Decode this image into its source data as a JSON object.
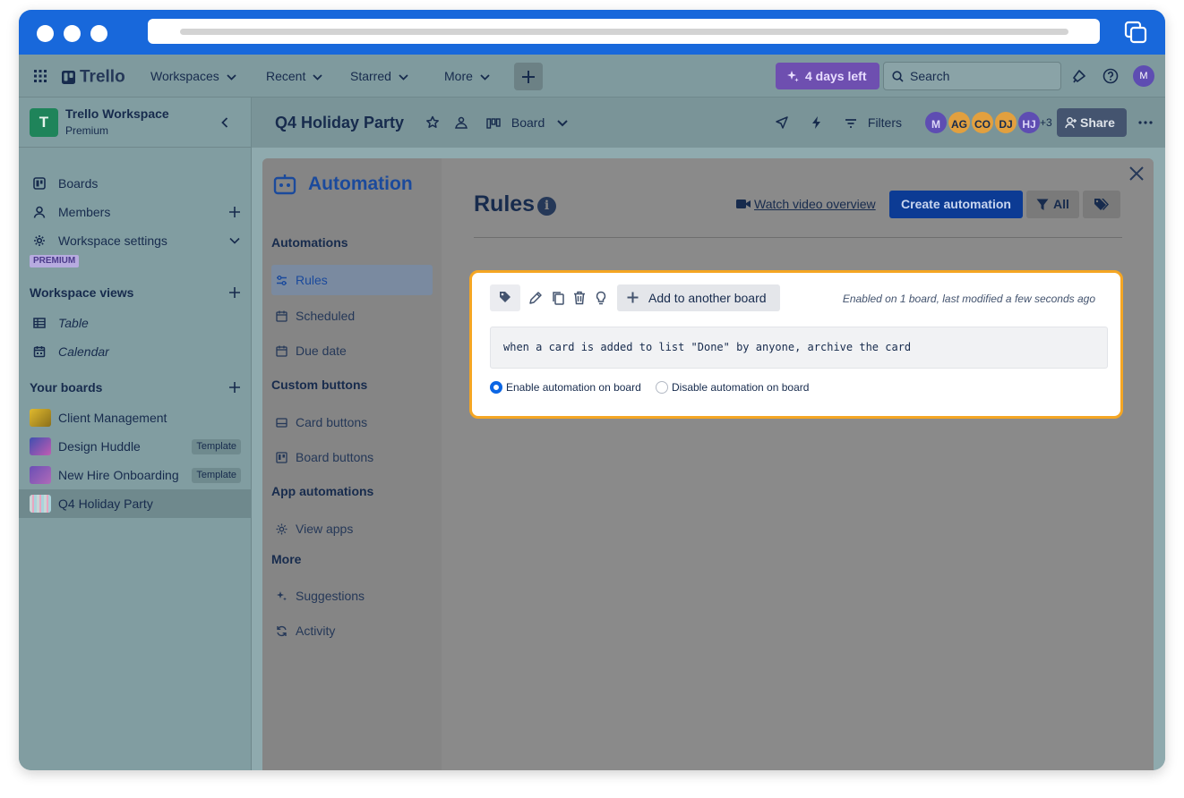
{
  "topnav": {
    "logo": "Trello",
    "menus": [
      "Workspaces",
      "Recent",
      "Starred",
      "More"
    ],
    "trial": "4 days left",
    "search_placeholder": "Search",
    "avatar": "M"
  },
  "sidebar": {
    "workspace_initial": "T",
    "workspace_name": "Trello Workspace",
    "workspace_plan": "Premium",
    "nav": [
      {
        "label": "Boards",
        "icon": "board-icon"
      },
      {
        "label": "Members",
        "icon": "person-icon"
      },
      {
        "label": "Workspace settings",
        "icon": "gear-icon"
      }
    ],
    "premium_tag": "PREMIUM",
    "views_title": "Workspace views",
    "views": [
      {
        "label": "Table",
        "icon": "table-icon"
      },
      {
        "label": "Calendar",
        "icon": "calendar-icon"
      }
    ],
    "boards_title": "Your boards",
    "boards": [
      {
        "label": "Client Management",
        "badge": "",
        "color": "#c9a227"
      },
      {
        "label": "Design Huddle",
        "badge": "Template",
        "color": "#7a4fb0"
      },
      {
        "label": "New Hire Onboarding",
        "badge": "Template",
        "color": "#8a5bb8"
      },
      {
        "label": "Q4 Holiday Party",
        "badge": "",
        "color": "#b8c4c4"
      }
    ]
  },
  "board_header": {
    "title": "Q4 Holiday Party",
    "view": "Board",
    "filters": "Filters",
    "members": [
      {
        "initials": "M",
        "color": "#5e4db2"
      },
      {
        "initials": "AG",
        "color": "#e2a03f"
      },
      {
        "initials": "CO",
        "color": "#e2a03f"
      },
      {
        "initials": "DJ",
        "color": "#e2a03f"
      },
      {
        "initials": "HJ",
        "color": "#5e4db2"
      }
    ],
    "more_members": "+3",
    "share": "Share"
  },
  "automation": {
    "title": "Automation",
    "sections": [
      {
        "title": "Automations",
        "items": [
          {
            "label": "Rules",
            "icon": "sliders-icon",
            "active": true
          },
          {
            "label": "Scheduled",
            "icon": "calendar-icon"
          },
          {
            "label": "Due date",
            "icon": "calendar-icon"
          }
        ]
      },
      {
        "title": "Custom buttons",
        "items": [
          {
            "label": "Card buttons",
            "icon": "card-icon"
          },
          {
            "label": "Board buttons",
            "icon": "board-icon"
          }
        ]
      },
      {
        "title": "App automations",
        "items": [
          {
            "label": "View apps",
            "icon": "gear-icon"
          }
        ]
      },
      {
        "title": "More",
        "items": [
          {
            "label": "Suggestions",
            "icon": "sparkle-icon"
          },
          {
            "label": "Activity",
            "icon": "refresh-icon"
          }
        ]
      }
    ],
    "rules_title": "Rules",
    "info": "i",
    "watch_video": "Watch video overview",
    "create": "Create automation",
    "filter_all": "All"
  },
  "rule": {
    "add_to_board": "Add to another board",
    "meta": "Enabled on 1 board, last modified a few seconds ago",
    "text": "when a card is added to list \"Done\" by anyone, archive the card",
    "enable_label": "Enable automation on board",
    "disable_label": "Disable automation on board",
    "enabled": true
  }
}
